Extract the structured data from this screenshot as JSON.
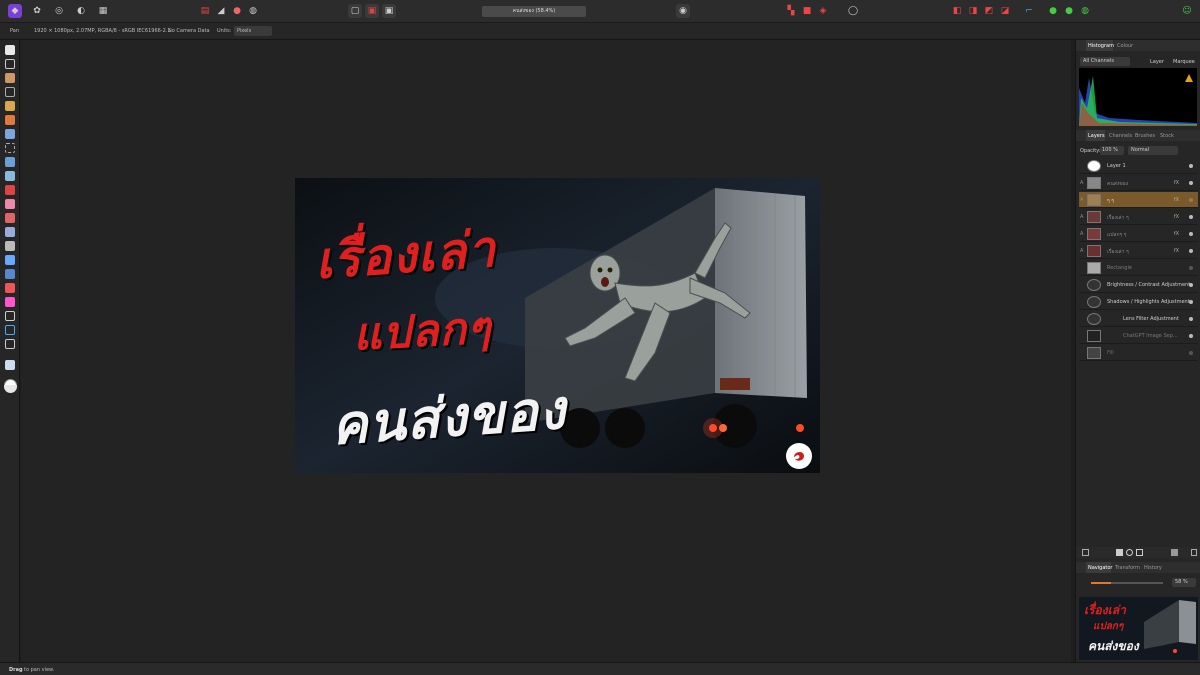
{
  "toolbar": {
    "document_title": "คนส่งของ (58.4%)"
  },
  "context": {
    "tool_name": "Pan",
    "doc_info": "1920 × 1080px, 2.07MP, RGBA/8 - sRGB IEC61966-2.1",
    "camera": "No Camera Data",
    "units_label": "Units:",
    "units_value": "Pixels"
  },
  "artwork": {
    "line1": "เรื่องเล่า",
    "line2": "แปลกๆ",
    "line3": "คนส่งของ"
  },
  "histogram_panel": {
    "tabs": [
      "Histogram",
      "Colour"
    ],
    "channels": "All Channels",
    "opt_layer": "Layer",
    "opt_marquee": "Marquee"
  },
  "layers_panel": {
    "tabs": [
      "Layers",
      "Channels",
      "Brushes",
      "Stock"
    ],
    "opacity_label": "Opacity:",
    "opacity_value": "100 %",
    "blend_mode": "Normal",
    "layers": [
      {
        "name": "Layer 1"
      },
      {
        "name": "คนส่งของ"
      },
      {
        "name": "ๆ ๆ"
      },
      {
        "name": "เรื่องเล่า ๆ"
      },
      {
        "name": "แปลกๆ ๆ"
      },
      {
        "name": "เรื่องเล่า ๆ"
      },
      {
        "name": "Rectangle"
      },
      {
        "name": "Brightness / Contrast Adjustment"
      },
      {
        "name": "Shadows / Highlights Adjustment"
      },
      {
        "name": "Lens Filter Adjustment"
      },
      {
        "name": "ChatGPT Image Sep..."
      },
      {
        "name": "Fill"
      }
    ]
  },
  "navigator_panel": {
    "tabs": [
      "Navigator",
      "Transform",
      "History"
    ],
    "zoom": "58 %"
  },
  "status": {
    "bold": "Drag",
    "text": "to pan view."
  }
}
